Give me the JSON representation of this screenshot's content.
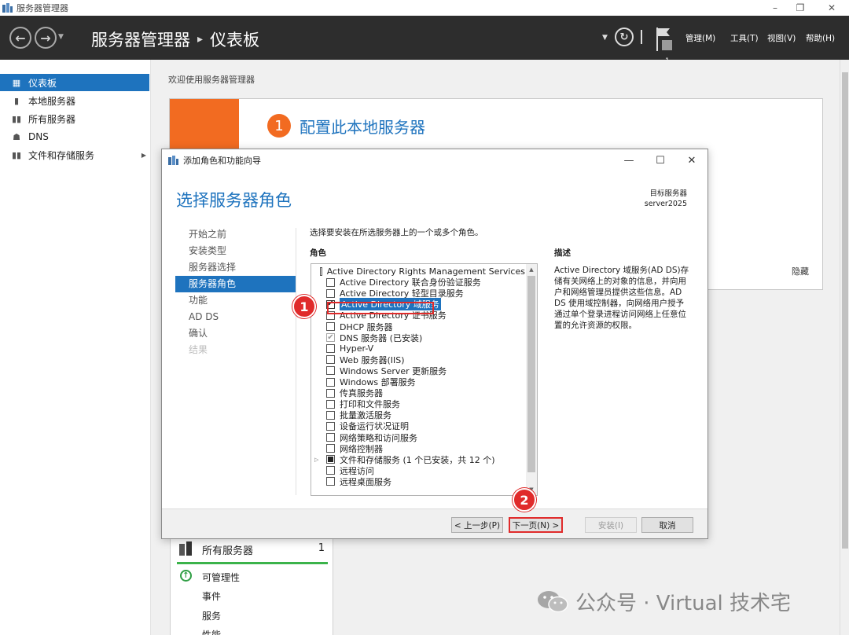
{
  "window": {
    "title": "服务器管理器",
    "minimize": "–",
    "restore": "❐",
    "close": "✕"
  },
  "header": {
    "back": "←",
    "forward": "→",
    "breadcrumb_app": "服务器管理器",
    "breadcrumb_sep": "▸",
    "breadcrumb_page": "仪表板",
    "refresh": "↻",
    "flag_count": "1",
    "menu": [
      "管理(M)",
      "工具(T)",
      "视图(V)",
      "帮助(H)"
    ]
  },
  "leftnav": {
    "items": [
      {
        "label": "仪表板",
        "icon": "dashboard-icon",
        "glyph": "▦"
      },
      {
        "label": "本地服务器",
        "icon": "server-icon",
        "glyph": "▮"
      },
      {
        "label": "所有服务器",
        "icon": "servers-icon",
        "glyph": "▮▮"
      },
      {
        "label": "DNS",
        "icon": "dns-icon",
        "glyph": "☗"
      },
      {
        "label": "文件和存储服务",
        "icon": "file-storage-icon",
        "glyph": "▮▮"
      }
    ],
    "expand_arrow": "▶"
  },
  "main": {
    "welcome": "欢迎使用服务器管理器",
    "step_number": "1",
    "config_link": "配置此本地服务器",
    "hide": "隐藏",
    "servers_panel": {
      "title": "所有服务器",
      "count": "1",
      "ok_glyph": "↑",
      "items": [
        "可管理性",
        "事件",
        "服务",
        "性能"
      ]
    }
  },
  "dialog": {
    "title": "添加角色和功能向导",
    "heading": "选择服务器角色",
    "target_label": "目标服务器",
    "target_value": "server2025",
    "steps": [
      {
        "label": "开始之前",
        "state": "normal"
      },
      {
        "label": "安装类型",
        "state": "normal"
      },
      {
        "label": "服务器选择",
        "state": "normal"
      },
      {
        "label": "服务器角色",
        "state": "active"
      },
      {
        "label": "功能",
        "state": "normal"
      },
      {
        "label": "AD DS",
        "state": "normal"
      },
      {
        "label": "确认",
        "state": "normal"
      },
      {
        "label": "结果",
        "state": "disabled"
      }
    ],
    "instruction": "选择要安装在所选服务器上的一个或多个角色。",
    "roles_header": "角色",
    "desc_header": "描述",
    "roles": [
      {
        "label": "Active Directory Rights Management Services",
        "state": "unchecked",
        "expand": false
      },
      {
        "label": "Active Directory 联合身份验证服务",
        "state": "unchecked",
        "expand": false
      },
      {
        "label": "Active Directory 轻型目录服务",
        "state": "unchecked",
        "expand": false
      },
      {
        "label": "Active Directory 域服务",
        "state": "checked",
        "expand": false,
        "selected": true
      },
      {
        "label": "Active Directory 证书服务",
        "state": "unchecked",
        "expand": false
      },
      {
        "label": "DHCP 服务器",
        "state": "unchecked",
        "expand": false
      },
      {
        "label": "DNS 服务器 (已安装)",
        "state": "installed",
        "expand": false
      },
      {
        "label": "Hyper-V",
        "state": "unchecked",
        "expand": false
      },
      {
        "label": "Web 服务器(IIS)",
        "state": "unchecked",
        "expand": false
      },
      {
        "label": "Windows Server 更新服务",
        "state": "unchecked",
        "expand": false
      },
      {
        "label": "Windows 部署服务",
        "state": "unchecked",
        "expand": false
      },
      {
        "label": "传真服务器",
        "state": "unchecked",
        "expand": false
      },
      {
        "label": "打印和文件服务",
        "state": "unchecked",
        "expand": false
      },
      {
        "label": "批量激活服务",
        "state": "unchecked",
        "expand": false
      },
      {
        "label": "设备运行状况证明",
        "state": "unchecked",
        "expand": false
      },
      {
        "label": "网络策略和访问服务",
        "state": "unchecked",
        "expand": false
      },
      {
        "label": "网络控制器",
        "state": "unchecked",
        "expand": false
      },
      {
        "label": "文件和存储服务 (1 个已安装，共 12 个)",
        "state": "partial",
        "expand": true
      },
      {
        "label": "远程访问",
        "state": "unchecked",
        "expand": false
      },
      {
        "label": "远程桌面服务",
        "state": "unchecked",
        "expand": false
      }
    ],
    "description": "Active Directory 域服务(AD DS)存储有关网络上的对象的信息，并向用户和网络管理员提供这些信息。AD DS 使用域控制器，向网络用户授予通过单个登录进程访问网络上任意位置的允许资源的权限。",
    "buttons": {
      "prev": "< 上一步(P)",
      "next": "下一页(N) >",
      "install": "安装(I)",
      "cancel": "取消"
    },
    "ctl": {
      "min": "—",
      "max": "☐",
      "close": "✕"
    }
  },
  "annotations": {
    "badge1": "1",
    "badge2": "2"
  },
  "watermark": {
    "text": "公众号 · Virtual 技术宅"
  },
  "colors": {
    "accent": "#1e73be",
    "orange": "#f26b21",
    "header": "#2d2d2d",
    "annotation": "#e02b2b",
    "ok": "#3bb34a"
  }
}
